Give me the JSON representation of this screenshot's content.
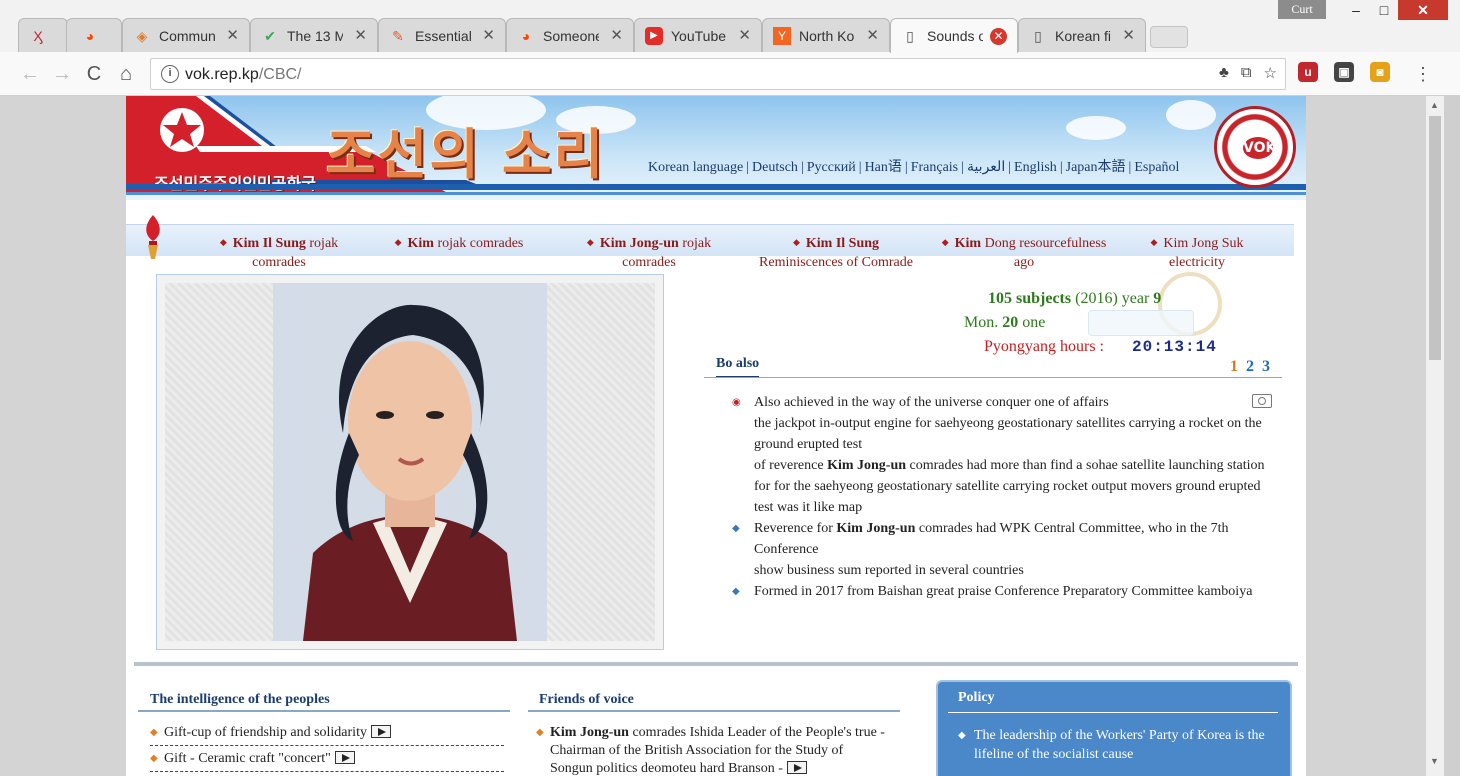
{
  "window": {
    "user_label": "Curt",
    "min_glyph": "–",
    "max_glyph": "□",
    "close_glyph": "✕"
  },
  "tabs": [
    {
      "icon": "Ӽ",
      "icon_name": "pdf-icon",
      "title": "",
      "close": "✕"
    },
    {
      "icon": "◕",
      "icon_name": "reddit-icon",
      "title": "",
      "close": ""
    },
    {
      "icon": "◈",
      "icon_name": "community-icon",
      "title": "Commun",
      "close": "✕"
    },
    {
      "icon": "✔",
      "icon_name": "check-icon",
      "title": "The 13 M",
      "close": "✕"
    },
    {
      "icon": "✎",
      "icon_name": "essential-icon",
      "title": "Essential",
      "close": "✕"
    },
    {
      "icon": "◕",
      "icon_name": "reddit-icon",
      "title": "Someone",
      "close": "✕"
    },
    {
      "icon": "▶",
      "icon_name": "youtube-icon",
      "title": "YouTube",
      "close": "✕"
    },
    {
      "icon": "Y",
      "icon_name": "ycombinator-icon",
      "title": "North Ko",
      "close": "✕"
    },
    {
      "icon": "▯",
      "icon_name": "page-icon",
      "title": "Sounds o",
      "close": "✕"
    },
    {
      "icon": "▯",
      "icon_name": "page-icon",
      "title": "Korean fi",
      "close": "✕"
    }
  ],
  "toolbar": {
    "back": "←",
    "forward": "→",
    "reload": "C",
    "home": "⌂",
    "info": "i",
    "url_host": "vok.rep.kp",
    "url_path": "/CBC/",
    "omni_icons": [
      "♣",
      "⧉",
      "☆"
    ],
    "extensions": [
      {
        "label": "u",
        "color": "#c0282d"
      },
      {
        "label": "▣",
        "color": "#444444"
      },
      {
        "label": "◙",
        "color": "#e6a11a"
      }
    ],
    "menu": "⋮"
  },
  "banner": {
    "title": "조선의 소리",
    "subtitle": "조선민주주의인민공화국",
    "languages": [
      "Korean language",
      "Deutsch",
      "Русский",
      "Han语",
      "Français",
      "العربية",
      "English",
      "Japan本語",
      "Español"
    ],
    "logo": "VOK"
  },
  "leaders": [
    {
      "bold": "Kim Il Sung",
      "rest": " rojak",
      "line2": "comrades"
    },
    {
      "bold": "Kim",
      "rest": " rojak comrades",
      "line2": ""
    },
    {
      "bold": "Kim Jong-un",
      "rest": " rojak",
      "line2": "comrades"
    },
    {
      "bold": "Kim Il Sung",
      "rest": "",
      "line2": "Reminiscences of Comrade"
    },
    {
      "bold": "Kim",
      "rest": " Dong resourcefulness",
      "line2": "ago"
    },
    {
      "bold": "",
      "rest": "Kim Jong Suk",
      "line2": "electricity"
    }
  ],
  "date": {
    "subjects_num": "105",
    "subjects_word": " subjects",
    "year_paren": " (2016) year ",
    "year_num": "9",
    "day_name": "Mon. ",
    "day_num": "20",
    "day_word": " one",
    "pyongyang_label": "Pyongyang hours :",
    "pyongyang_time": "20:13:14"
  },
  "news": {
    "tab_label": "Bo also",
    "pages": [
      "1",
      "2",
      "3"
    ],
    "items": [
      {
        "lines": [
          {
            "pre": "Also achieved in the way of the universe conquer one of affairs",
            "bold": "",
            "post": ""
          },
          {
            "pre": "the jackpot in-output engine for saehyeong geostationary satellites carrying a rocket on the ground erupted test",
            "bold": "",
            "post": ""
          },
          {
            "pre": "of reverence ",
            "bold": "Kim Jong-un",
            "post": " comrades had more than find a sohae satellite launching station"
          },
          {
            "pre": "for for the saehyeong geostationary satellite carrying rocket output movers ground erupted test was it like map",
            "bold": "",
            "post": ""
          }
        ]
      },
      {
        "lines": [
          {
            "pre": "Reverence for ",
            "bold": "Kim Jong-un",
            "post": " comrades had WPK Central Committee, who in the 7th Conference"
          },
          {
            "pre": "show business sum reported in several countries",
            "bold": "",
            "post": ""
          }
        ]
      },
      {
        "lines": [
          {
            "pre": "Formed in 2017 from Baishan great praise Conference Preparatory Committee kamboiya",
            "bold": "",
            "post": ""
          }
        ]
      }
    ]
  },
  "columns": {
    "peoples": {
      "title": "The intelligence of the peoples",
      "items": [
        "Gift-cup of friendship and solidarity",
        "Gift - Ceramic craft \"concert\""
      ]
    },
    "friends": {
      "title": "Friends of voice",
      "item_bold": "Kim Jong-un",
      "item_rest": " comrades Ishida Leader of the People's true - Chairman of the British Association for the Study of Songun politics deomoteu hard Branson -"
    },
    "policy": {
      "title": "Policy",
      "item": "The leadership of the Workers' Party of Korea is the lifeline of the socialist cause"
    }
  }
}
